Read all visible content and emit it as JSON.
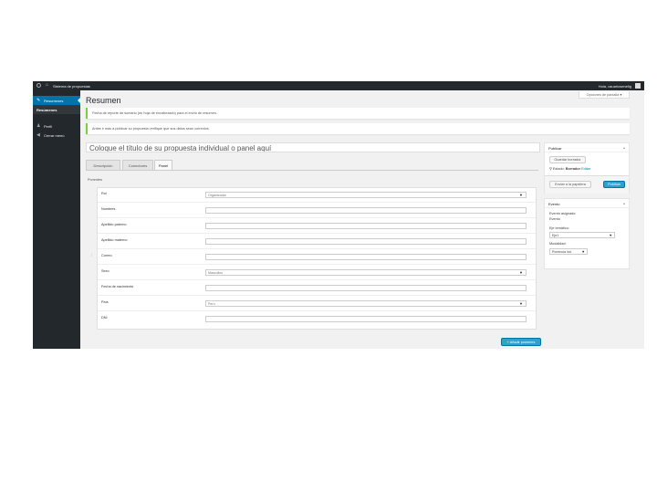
{
  "admin_bar": {
    "home_glyph": "⌂",
    "site_name": "Sistema de propuestas",
    "user_greeting": "Hola, usuariosenelig"
  },
  "sidebar": {
    "items": [
      {
        "label": "Resumenes",
        "icon": "pin-icon",
        "glyph": "✎"
      },
      {
        "label": "Resúmenes"
      },
      {
        "label": "Perfil",
        "icon": "user-icon",
        "glyph": "♟"
      },
      {
        "label": "Cerrar menú",
        "icon": "collapse-icon",
        "glyph": "◀"
      }
    ]
  },
  "header": {
    "screen_options": "Opciones de pantalla ▾",
    "page_title": "Resumen"
  },
  "notices": [
    "Fecha de reporte de sumario (en hoja de encabezado) para el envío de resumen.",
    "Antes ir más a publicar su propuesta verifique que sus datos sean correctos."
  ],
  "editor": {
    "title_placeholder": "Coloque el título de su propuesta individual o panel aquí",
    "tabs": [
      "Descripción",
      "Conectores",
      "Panel"
    ],
    "active_tab": "Panel",
    "section_label": "Ponentes",
    "handle_glyph": "⁝",
    "fields": [
      {
        "label": "Rol",
        "type": "select",
        "value": "Organizador"
      },
      {
        "label": "Nombres",
        "type": "text",
        "value": ""
      },
      {
        "label": "Apellido paterno",
        "type": "text",
        "value": ""
      },
      {
        "label": "Apellido materno",
        "type": "text",
        "value": ""
      },
      {
        "label": "Correo",
        "type": "text",
        "value": ""
      },
      {
        "label": "Sexo",
        "type": "select",
        "value": "Masculino"
      },
      {
        "label": "Fecha de nacimiento",
        "type": "text",
        "value": ""
      },
      {
        "label": "País",
        "type": "select",
        "value": "Perú"
      },
      {
        "label": "DNI",
        "type": "text",
        "value": ""
      }
    ],
    "caret": "▼",
    "add_button": "+ Añadir ponentes"
  },
  "publish_box": {
    "title": "Publicar",
    "toggle": "▴",
    "save_draft": "Guardar borrador",
    "status_icon": "key-icon",
    "status_glyph": "⚲",
    "status_label": "Estado:",
    "status_value": "Borrador",
    "edit_link": "Editar",
    "trash": "Enviar a la papelera",
    "publish": "Publicar"
  },
  "event_box": {
    "title": "Evento",
    "toggle": "▴",
    "event_label": "Evento asignado:",
    "event_value": "Evento",
    "theme_label": "Eje temático:",
    "theme_value": "Eje1",
    "mod_label": "Modalidad:",
    "mod_value": "Ponencia ind."
  },
  "colors": {
    "admin_dark": "#23282d",
    "accent_blue": "#0073aa",
    "button_blue": "#2ea2cc",
    "notice_green": "#7ad03a"
  }
}
